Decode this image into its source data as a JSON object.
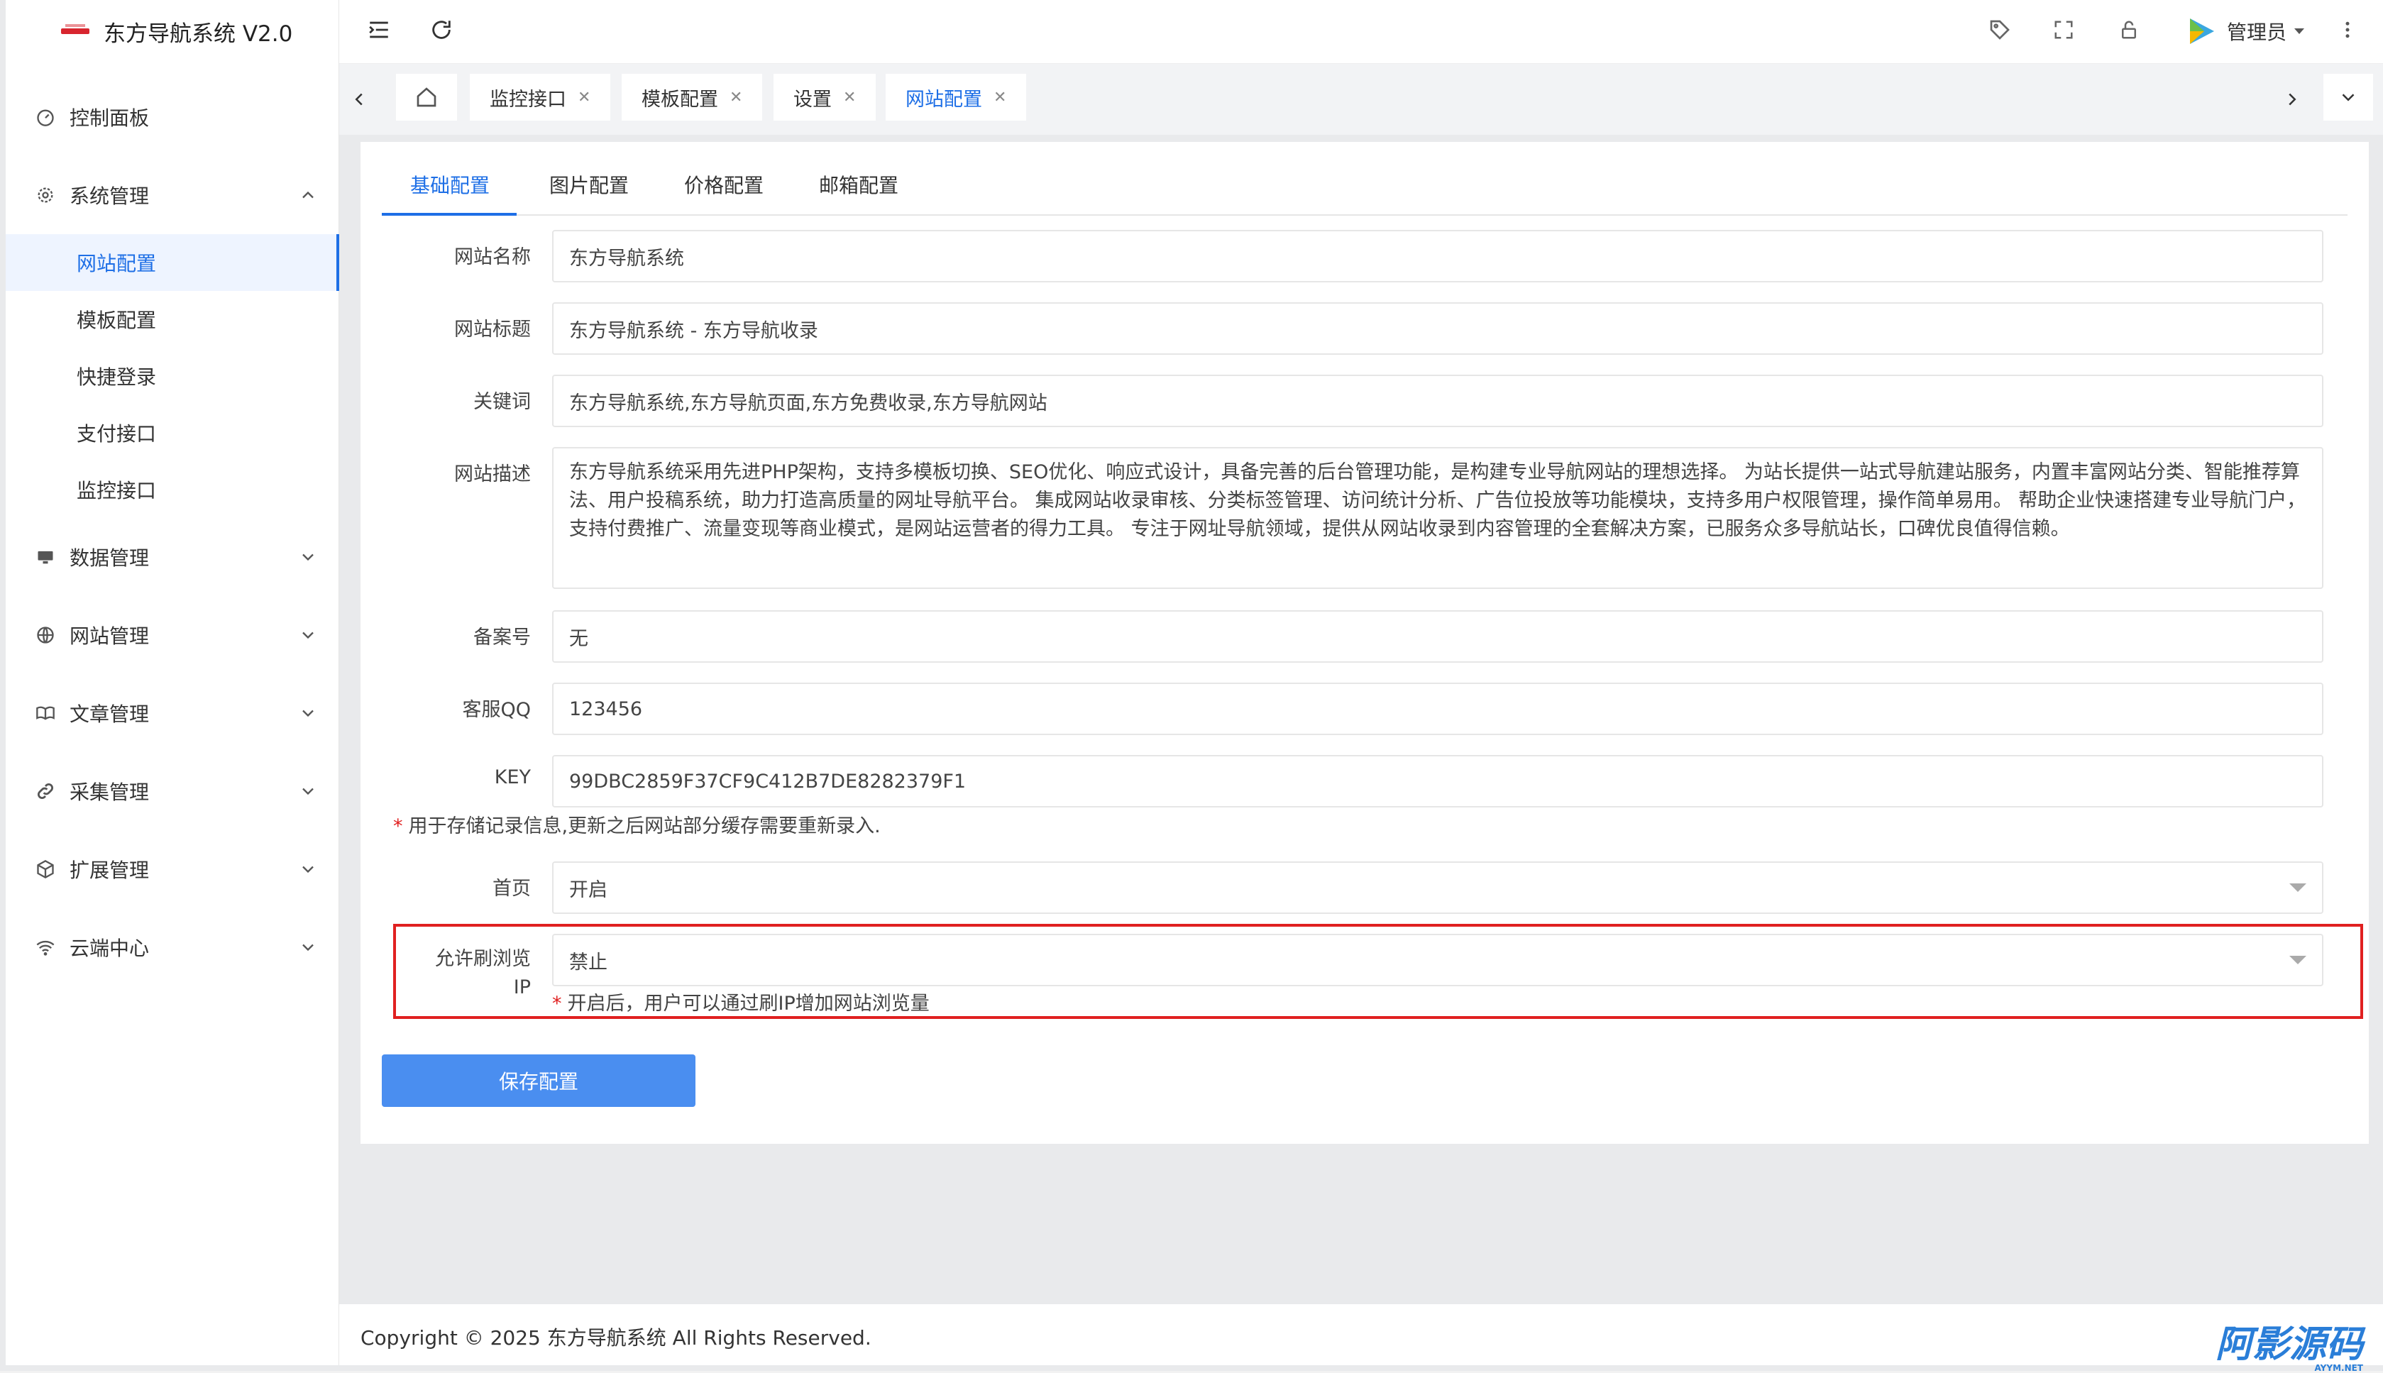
{
  "app": {
    "title": "东方导航系统 V2.0"
  },
  "sidebar": {
    "items": [
      {
        "label": "控制面板",
        "icon": "dashboard-icon"
      },
      {
        "label": "系统管理",
        "icon": "gear-icon",
        "expanded": true,
        "children": [
          "网站配置",
          "模板配置",
          "快捷登录",
          "支付接口",
          "监控接口"
        ]
      },
      {
        "label": "数据管理",
        "icon": "monitor-icon"
      },
      {
        "label": "网站管理",
        "icon": "globe-icon"
      },
      {
        "label": "文章管理",
        "icon": "book-icon"
      },
      {
        "label": "采集管理",
        "icon": "link-icon"
      },
      {
        "label": "扩展管理",
        "icon": "cube-icon"
      },
      {
        "label": "云端中心",
        "icon": "wifi-icon"
      }
    ],
    "active_child": "网站配置"
  },
  "topbar": {
    "user": "管理员"
  },
  "tabs": [
    {
      "label": "监控接口"
    },
    {
      "label": "模板配置"
    },
    {
      "label": "设置"
    },
    {
      "label": "网站配置",
      "active": true
    }
  ],
  "config_tabs": [
    "基础配置",
    "图片配置",
    "价格配置",
    "邮箱配置"
  ],
  "form": {
    "site_name": {
      "label": "网站名称",
      "value": "东方导航系统"
    },
    "site_title": {
      "label": "网站标题",
      "value": "东方导航系统 - 东方导航收录"
    },
    "keywords": {
      "label": "关键词",
      "value": "东方导航系统,东方导航页面,东方免费收录,东方导航网站"
    },
    "description": {
      "label": "网站描述",
      "value": "东方导航系统采用先进PHP架构，支持多模板切换、SEO优化、响应式设计，具备完善的后台管理功能，是构建专业导航网站的理想选择。 为站长提供一站式导航建站服务，内置丰富网站分类、智能推荐算法、用户投稿系统，助力打造高质量的网址导航平台。 集成网站收录审核、分类标签管理、访问统计分析、广告位投放等功能模块，支持多用户权限管理，操作简单易用。 帮助企业快速搭建专业导航门户，支持付费推广、流量变现等商业模式，是网站运营者的得力工具。 专注于网址导航领域，提供从网站收录到内容管理的全套解决方案，已服务众多导航站长，口碑优良值得信赖。"
    },
    "icp": {
      "label": "备案号",
      "value": "无"
    },
    "qq": {
      "label": "客服QQ",
      "value": "123456"
    },
    "key": {
      "label": "KEY",
      "value": "99DBC2859F37CF9C412B7DE8282379F1"
    },
    "key_hint": "用于存储记录信息,更新之后网站部分缓存需要重新录入.",
    "home": {
      "label": "首页",
      "value": "开启"
    },
    "allow_ip": {
      "label": "允许刷浏览",
      "label2": "IP",
      "value": "禁止",
      "hint": "开启后，用户可以通过刷IP增加网站浏览量"
    },
    "save_label": "保存配置"
  },
  "footer": {
    "copyright": "Copyright © 2025 东方导航系统 All Rights Reserved.",
    "watermark": "阿影源码",
    "watermark_sub": "AYYM.NET"
  },
  "colors": {
    "accent": "#1e6fe6",
    "button": "#4a8ef0",
    "highlight": "#e02020"
  }
}
